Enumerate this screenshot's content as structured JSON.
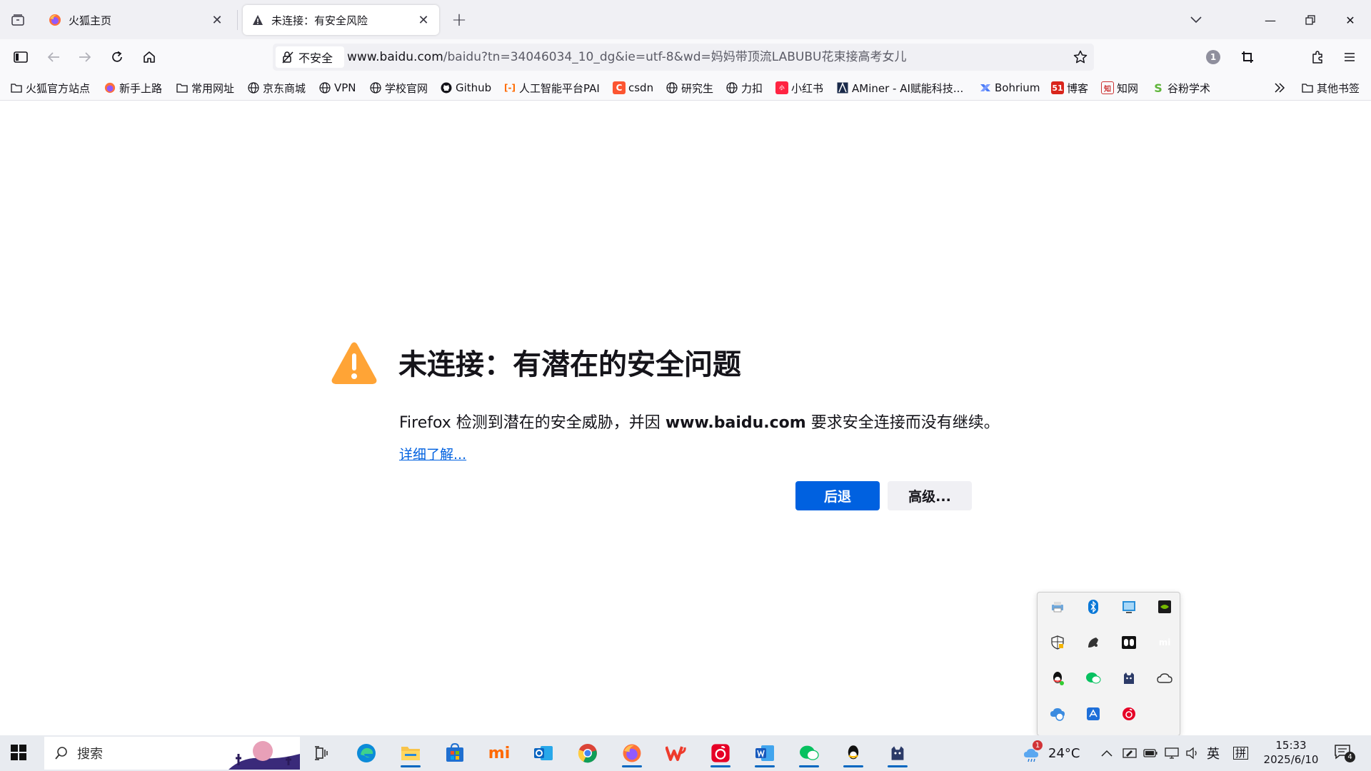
{
  "tabs": [
    {
      "title": "火狐主页",
      "icon": "firefox-icon"
    },
    {
      "title": "未连接：有安全风险",
      "icon": "warning-icon"
    }
  ],
  "urlbar": {
    "security_label": "不安全",
    "url_host": "www.baidu.com",
    "url_path": "/baidu?tn=34046034_10_dg&ie=utf-8&wd=妈妈带顶流LABUBU花束接高考女儿",
    "extension_badge": "1"
  },
  "bookmarks": [
    {
      "label": "火狐官方站点",
      "icon": "folder-icon"
    },
    {
      "label": "新手上路",
      "icon": "firefox-icon"
    },
    {
      "label": "常用网址",
      "icon": "folder-icon"
    },
    {
      "label": "京东商城",
      "icon": "globe-icon"
    },
    {
      "label": "VPN",
      "icon": "globe-icon"
    },
    {
      "label": "学校官网",
      "icon": "globe-icon"
    },
    {
      "label": "Github",
      "icon": "github-icon"
    },
    {
      "label": "人工智能平台PAI",
      "icon": "aliyun-icon"
    },
    {
      "label": "csdn",
      "icon": "csdn-icon"
    },
    {
      "label": "研究生",
      "icon": "globe-icon"
    },
    {
      "label": "力扣",
      "icon": "globe-icon"
    },
    {
      "label": "小红书",
      "icon": "xiaohongshu-icon"
    },
    {
      "label": "AMiner - AI赋能科技...",
      "icon": "aminer-icon"
    },
    {
      "label": "Bohrium",
      "icon": "bohrium-icon"
    },
    {
      "label": "博客",
      "icon": "cnblogs-icon"
    },
    {
      "label": "知网",
      "icon": "cnki-icon"
    },
    {
      "label": "谷粉学术",
      "icon": "gfsoso-icon"
    }
  ],
  "other_bookmarks": "其他书签",
  "error": {
    "title": "未连接：有潜在的安全问题",
    "desc_before": "Firefox 检测到潜在的安全威胁，并因 ",
    "desc_host": "www.baidu.com",
    "desc_after": " 要求安全连接而没有继续。",
    "learn_more": "详细了解...",
    "back_label": "后退",
    "advanced_label": "高级..."
  },
  "taskbar": {
    "search_placeholder": "搜索",
    "weather_temp": "24°C",
    "weather_badge": "1",
    "ime_lang": "英",
    "ime_mode": "拼",
    "time": "15:33",
    "date": "2025/6/10",
    "notification_count": "4"
  },
  "colors": {
    "accent": "#0061e0",
    "warning": "#ffa436"
  }
}
